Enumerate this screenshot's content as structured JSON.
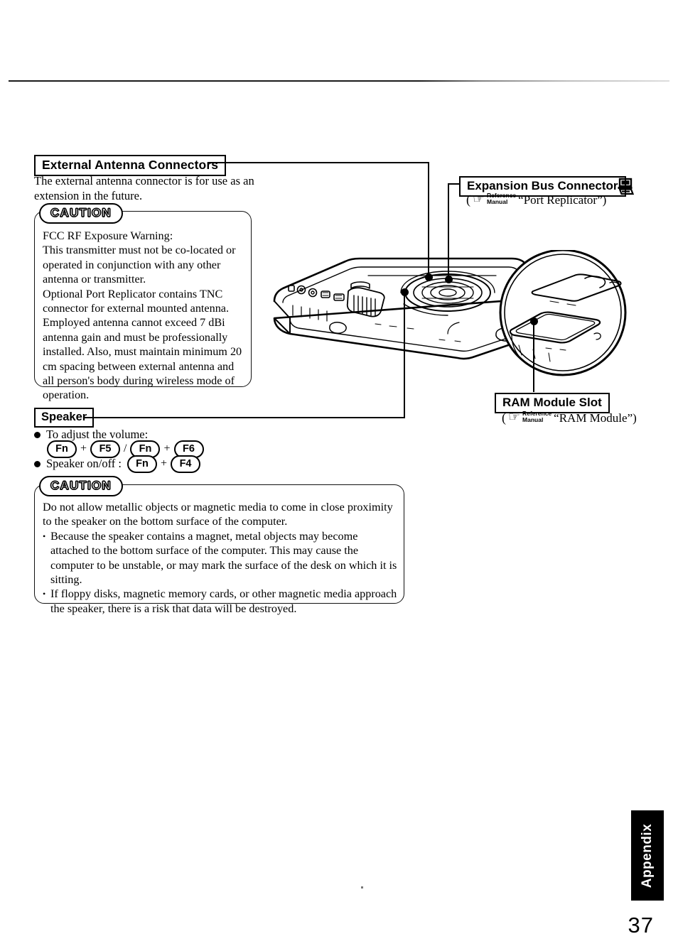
{
  "page": {
    "number": "37",
    "tab_label": "Appendix"
  },
  "sections": {
    "external_antenna": {
      "title": "External Antenna Connectors",
      "body": "The external antenna connector is for use as an extension in the future.",
      "caution": {
        "badge": "CAUTION",
        "heading": "FCC RF Exposure Warning:",
        "paragraph1": "This transmitter must not be co-located or operated in conjunction with any other antenna or transmitter.",
        "paragraph2": "Optional Port Replicator contains TNC connector for external mounted antenna.  Employed antenna cannot exceed 7 dBi antenna gain and must be professionally installed.  Also, must maintain minimum 20 cm spacing between external antenna and all person's body during wireless mode of operation."
      }
    },
    "speaker": {
      "title": "Speaker",
      "bullet_volume": "To adjust the volume:",
      "bullet_onoff": "Speaker on/off :",
      "keys": {
        "fn": "Fn",
        "f4": "F4",
        "f5": "F5",
        "f6": "F6",
        "plus": "+",
        "slash": "/"
      },
      "caution": {
        "badge": "CAUTION",
        "intro": "Do not allow metallic objects or magnetic media to come in close proximity to the speaker on the bottom surface of the computer.",
        "items": [
          "Because the speaker contains a magnet, metal objects may become attached to the bottom surface of the computer.  This may cause the computer to be unstable, or may mark the surface of the desk on which it is sitting.",
          "If floppy disks, magnetic memory cards, or other magnetic media approach the speaker, there is a risk that data will be destroyed."
        ]
      }
    },
    "expansion_bus": {
      "title": "Expansion Bus Connector",
      "reference": {
        "open_paren": "(",
        "hand": "☞",
        "manual_line1": "Reference",
        "manual_line2": "Manual",
        "quoted": "“Port Replicator”)"
      }
    },
    "ram_module": {
      "title": "RAM Module Slot",
      "reference": {
        "open_paren": "(",
        "hand": "☞",
        "manual_line1": "Reference",
        "manual_line2": "Manual",
        "quoted": "“RAM Module”)"
      }
    }
  },
  "icons": {
    "expansion_bus_device": "computer-device-icon",
    "reference_hand": "pointing-hand-icon"
  },
  "colors": {
    "ink": "#000000",
    "paper": "#ffffff"
  }
}
